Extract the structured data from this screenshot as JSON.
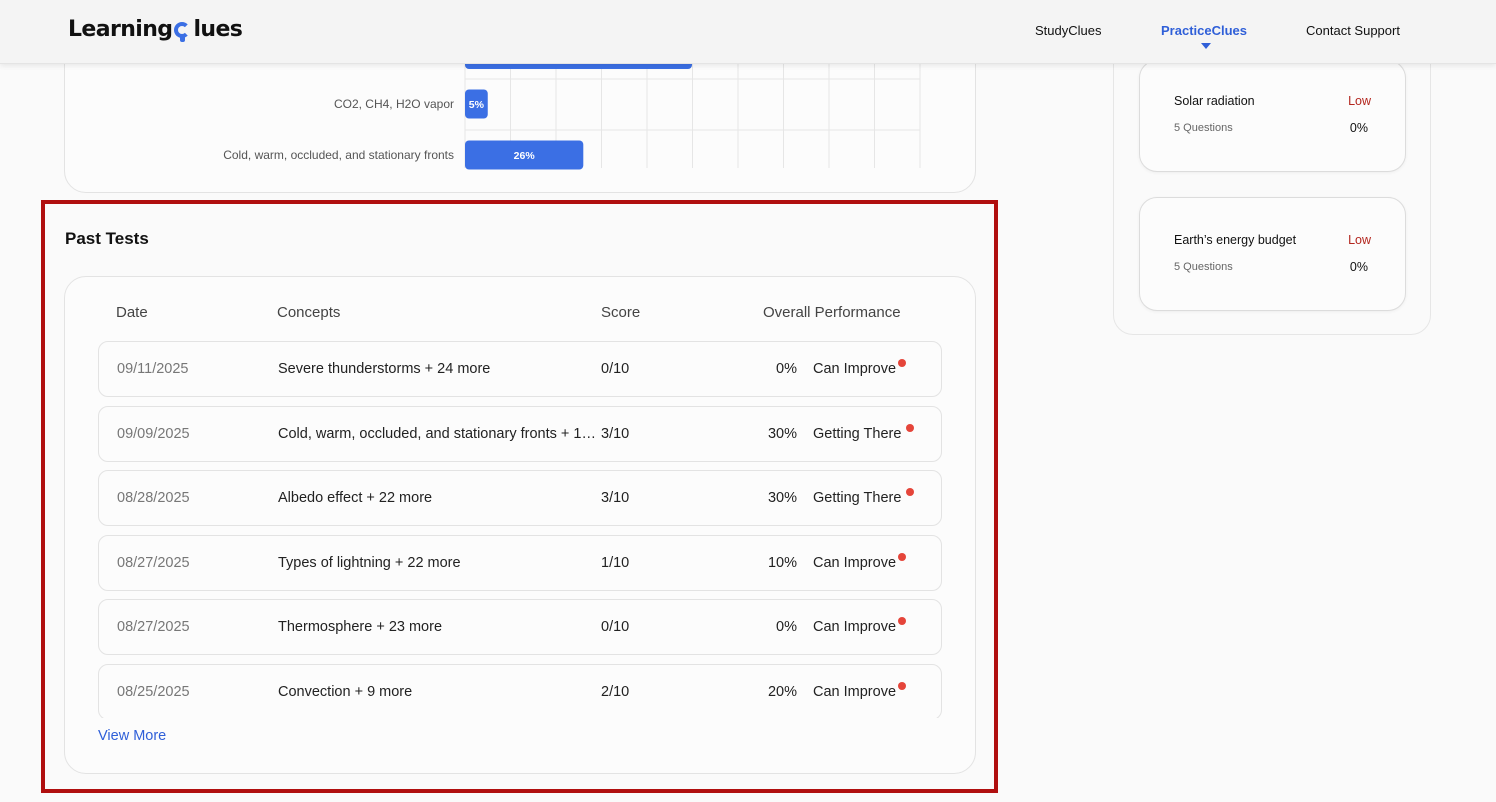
{
  "header": {
    "logo_left": "Learning",
    "logo_right": "lues",
    "nav": [
      "StudyClues",
      "PracticeClues",
      "Contact Support"
    ],
    "active_nav": "PracticeClues",
    "accent_color": "#2f5fd8"
  },
  "chart_data": {
    "type": "bar",
    "orientation": "horizontal",
    "categories": [
      "",
      "CO2, CH4, H2O vapor",
      "Cold, warm, occluded, and stationary fronts"
    ],
    "values": [
      null,
      5,
      26
    ],
    "value_labels": [
      "",
      "5%",
      "26%"
    ],
    "xlim": [
      0,
      100
    ],
    "grid": true,
    "bar_color": "#3b6fe4"
  },
  "concepts": [
    {
      "name": "Solar radiation",
      "level": "Low",
      "count": "5 Questions",
      "percent": "0%"
    },
    {
      "name": "Earth’s energy budget",
      "level": "Low",
      "count": "5 Questions",
      "percent": "0%"
    }
  ],
  "past_tests": {
    "title": "Past Tests",
    "headers": {
      "date": "Date",
      "concepts": "Concepts",
      "score": "Score",
      "performance": "Overall Performance"
    },
    "rows": [
      {
        "date": "09/11/2025",
        "concepts": "Severe thunderstorms + 24 more",
        "score": "0/10",
        "percent": "0%",
        "performance": "Can Improve"
      },
      {
        "date": "09/09/2025",
        "concepts": "Cold, warm, occluded, and stationary fronts + 1…",
        "score": "3/10",
        "percent": "30%",
        "performance": "Getting There"
      },
      {
        "date": "08/28/2025",
        "concepts": "Albedo effect + 22 more",
        "score": "3/10",
        "percent": "30%",
        "performance": "Getting There"
      },
      {
        "date": "08/27/2025",
        "concepts": "Types of lightning + 22 more",
        "score": "1/10",
        "percent": "10%",
        "performance": "Can Improve"
      },
      {
        "date": "08/27/2025",
        "concepts": "Thermosphere + 23 more",
        "score": "0/10",
        "percent": "0%",
        "performance": "Can Improve"
      },
      {
        "date": "08/25/2025",
        "concepts": "Convection + 9 more",
        "score": "2/10",
        "percent": "20%",
        "performance": "Can Improve"
      }
    ],
    "view_more": "View More",
    "status_dot_color": "#e5453a"
  }
}
